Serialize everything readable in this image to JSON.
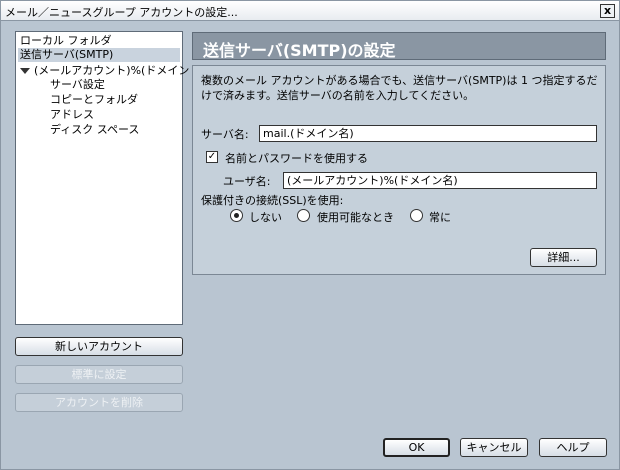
{
  "window": {
    "title": "メール／ニュースグループ アカウントの設定...",
    "close_glyph": "x"
  },
  "tree": {
    "items": [
      {
        "label": "ローカル フォルダ"
      },
      {
        "label": "送信サーバ(SMTP)"
      },
      {
        "label": "(メールアカウント)%(ドメイン"
      },
      {
        "label": "サーバ設定"
      },
      {
        "label": "コピーとフォルダ"
      },
      {
        "label": "アドレス"
      },
      {
        "label": "ディスク スペース"
      }
    ]
  },
  "side_buttons": {
    "new_account": "新しいアカウント",
    "set_default": "標準に設定",
    "delete_account": "アカウントを削除"
  },
  "panel": {
    "header": "送信サーバ(SMTP)の設定",
    "description": "複数のメール アカウントがある場合でも、送信サーバ(SMTP)は 1 つ指定するだけで済みます。送信サーバの名前を入力してください。",
    "server_label": "サーバ名:",
    "server_value": "mail.(ドメイン名)",
    "use_auth_label": "名前とパスワードを使用する",
    "use_auth_checked": true,
    "username_label": "ユーザ名:",
    "username_value": "(メールアカウント)%(ドメイン名)",
    "ssl_label": "保護付きの接続(SSL)を使用:",
    "ssl_options": [
      {
        "label": "しない",
        "selected": true
      },
      {
        "label": "使用可能なとき",
        "selected": false
      },
      {
        "label": "常に",
        "selected": false
      }
    ],
    "advanced_button": "詳細..."
  },
  "footer": {
    "ok": "OK",
    "cancel": "キャンセル",
    "help": "ヘルプ"
  }
}
